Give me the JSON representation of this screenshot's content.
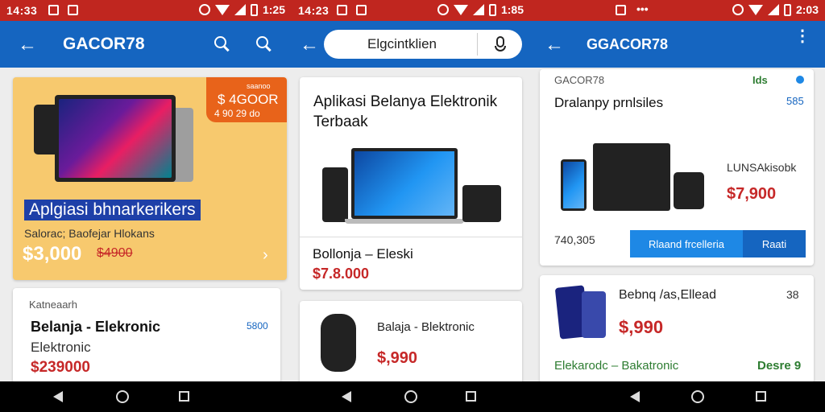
{
  "status": {
    "s1": {
      "time": "14:33",
      "right": "1:25"
    },
    "s2": {
      "time": "14:23",
      "right": "1:85"
    },
    "s3": {
      "right": "2:03"
    }
  },
  "s1": {
    "title": "GACOR78",
    "card1": {
      "badge_line1": "$ 4GOOR",
      "badge_line2": "4 90 29 do",
      "badge_small": "saanoo",
      "heading": "Aplgiasi  bhnarkerikers",
      "subtitle": "Salorac; Baofejar Hlokans",
      "price": "$3,000",
      "old_price": "$4900",
      "chevron": "›"
    },
    "card2": {
      "label": "Katneaarh",
      "title": "Belanja - Elekronic",
      "subtitle": "Elektronic",
      "price": "$239000",
      "side": "5800"
    }
  },
  "s2": {
    "search_value": "Elgcintklien",
    "card1": {
      "title": "Aplikasi Belanya Elektronik Terbaak",
      "name": "Bollonja – Eleski",
      "price": "$7.8.000"
    },
    "card2": {
      "name": "Balaja - Blektronic",
      "price": "$,990"
    }
  },
  "s3": {
    "title": "GGACOR78",
    "card1": {
      "brand": "GACOR78",
      "tag": "Ids",
      "heading": "Dralanpy prnlsiles",
      "side": "585",
      "model": "LUNSAkisobk",
      "price": "$7,900",
      "price_left": "740,305",
      "button_primary": "Rlaand frcelleria",
      "button_secondary": "Raati"
    },
    "card2": {
      "name": "Bebnq /as,Ellead",
      "side": "38",
      "price": "$,990",
      "category": "Elekarodc – Bakatronic",
      "status": "Desre 9"
    }
  },
  "colors": {
    "status_bar": "#c0261f",
    "app_bar": "#1565c0",
    "price": "#c62828",
    "promo_bg": "#f7c96e",
    "badge": "#e8631a",
    "heading_highlight": "#1e40a8",
    "primary_button": "#1e88e5",
    "secondary_button": "#1565c0",
    "green": "#2e7d32"
  }
}
